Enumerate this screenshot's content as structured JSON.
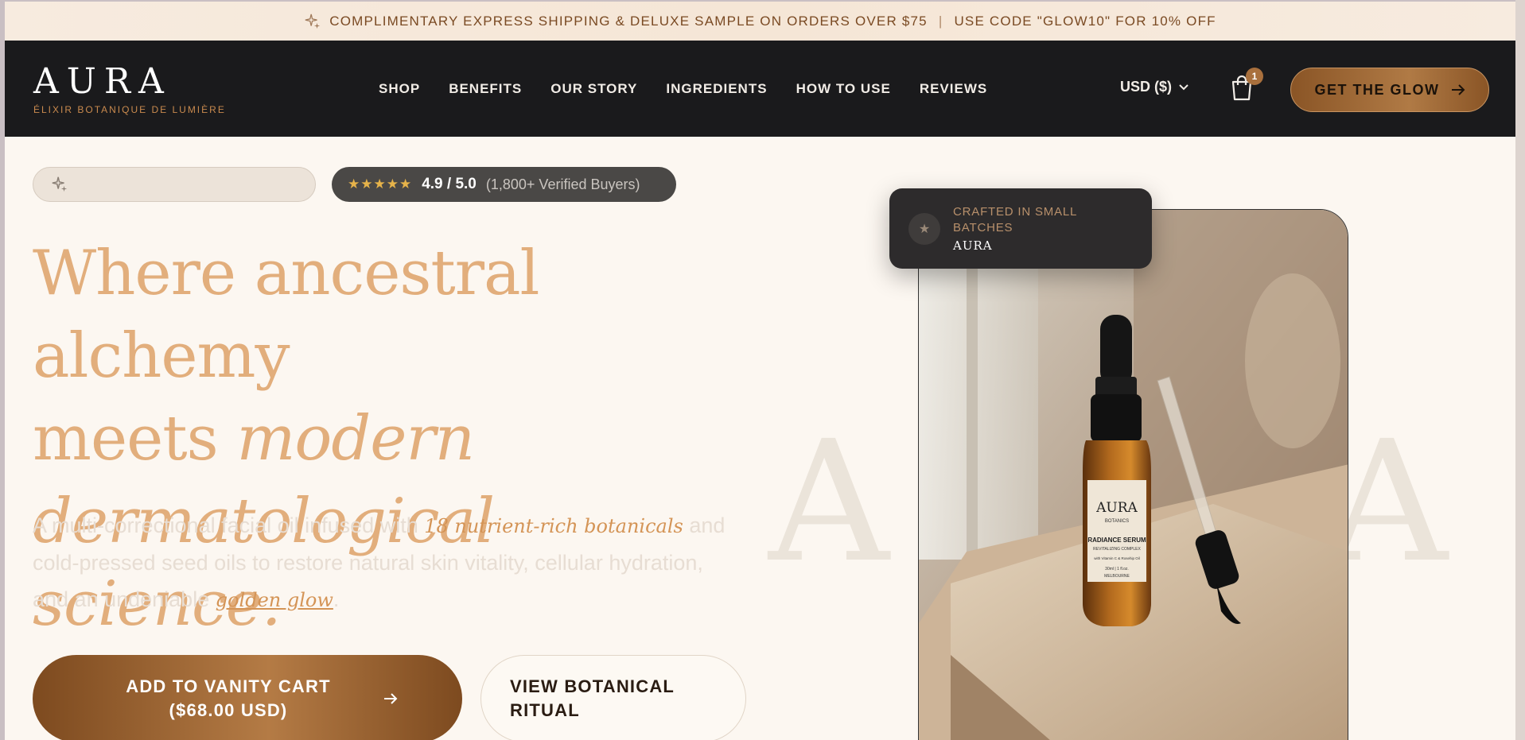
{
  "announcement": {
    "icon": "sparkle-icon",
    "text": "COMPLIMENTARY EXPRESS SHIPPING & DELUXE SAMPLE ON ORDERS OVER $75",
    "separator": "|",
    "promo": "USE CODE \"GLOW10\" FOR 10% OFF"
  },
  "header": {
    "logo": "AURA",
    "tagline": "ÉLIXIR BOTANIQUE DE LUMIÈRE",
    "nav": [
      "SHOP",
      "BENEFITS",
      "OUR STORY",
      "INGREDIENTS",
      "HOW TO USE",
      "REVIEWS"
    ],
    "currency": "USD ($)",
    "cart_count": "1",
    "cta": "GET THE GLOW"
  },
  "hero": {
    "rating": {
      "stars": "★★★★★",
      "value": "4.9 / 5.0",
      "note": "(1,800+ Verified Buyers)"
    },
    "headline": {
      "line1": "Where ancestral alchemy",
      "line2_plain": "meets ",
      "line2_italic": "modern",
      "line3_italic": "dermatological science."
    },
    "subcopy": {
      "part1": "A multi-correctional facial oil infused with ",
      "highlight1": "18 nutrient-rich botanicals",
      "part2": " and cold-pressed seed oils to restore natural skin vitality, cellular hydration, and an undeniable ",
      "highlight2": "golden glow",
      "part3": "."
    },
    "primary_button": "ADD TO VANITY CART ($68.00 USD)",
    "secondary_button": "VIEW BOTANICAL RITUAL",
    "background_letters": [
      "A",
      "A"
    ]
  },
  "product_card": {
    "crafted_line": "CRAFTED IN SMALL BATCHES",
    "crafted_brand": "AURA",
    "label_brand": "AURA",
    "label_sub": "BOTANICS",
    "label_title": "RADIANCE SERUM",
    "label_subtitle": "REVITALIZING COMPLEX",
    "label_desc": "with Vitamin C & Rosehip Oil",
    "label_size": "30ml | 1 fl.oz.",
    "label_city": "MELBOURNE"
  }
}
